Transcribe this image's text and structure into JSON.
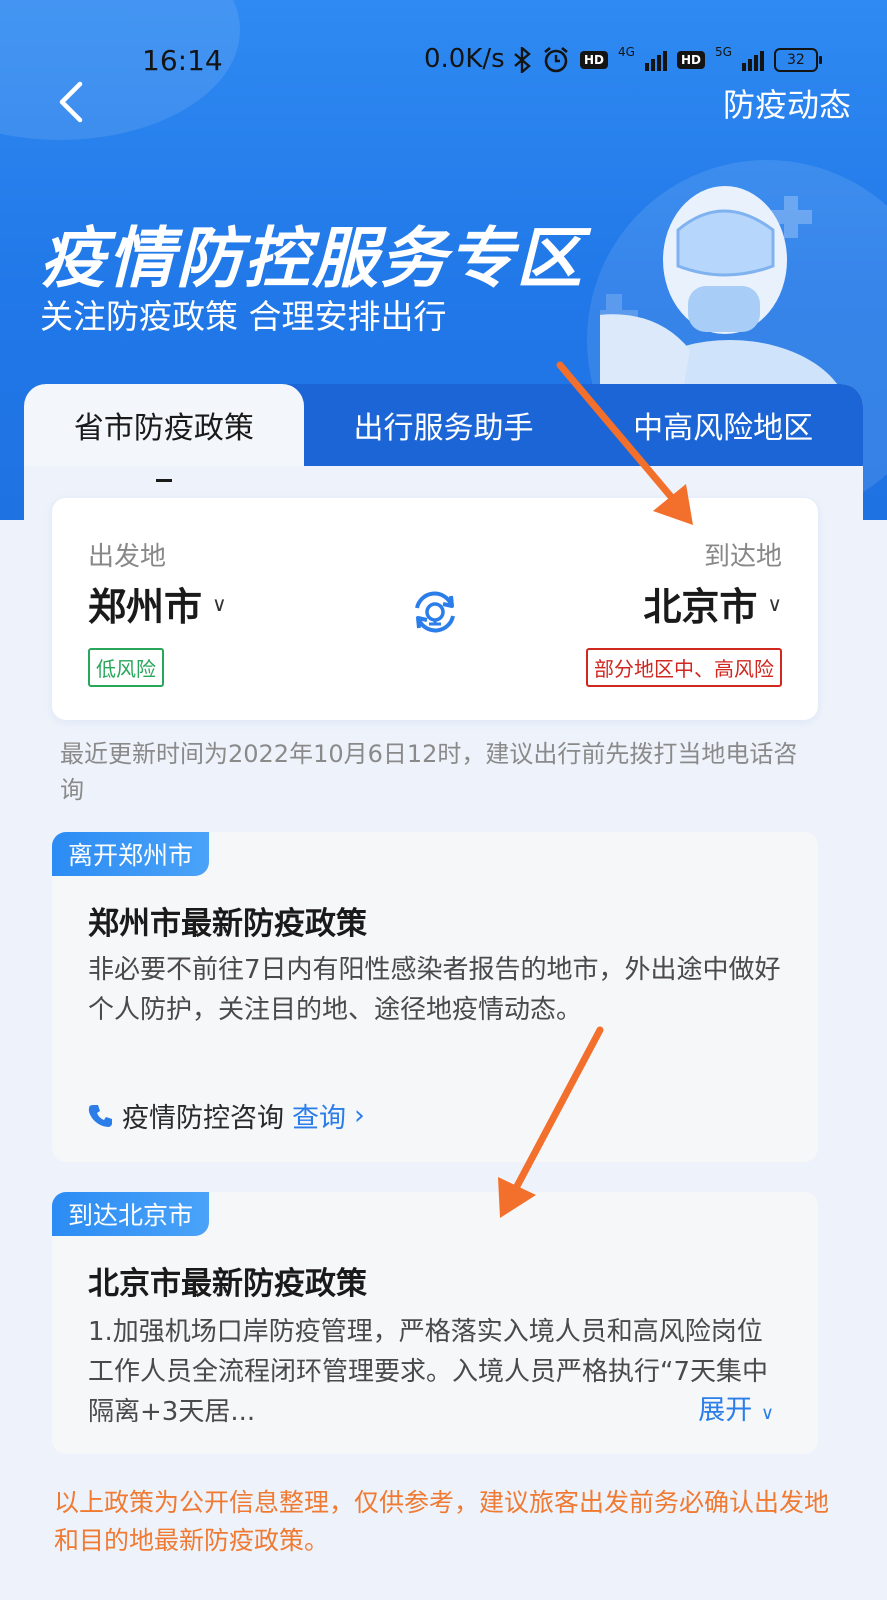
{
  "status_bar": {
    "time": "16:14",
    "net_speed": "0.0K/s",
    "net1": "4G",
    "net2": "5G",
    "hd_label": "HD",
    "battery": "32"
  },
  "header": {
    "back_icon": "back-chevron-icon",
    "link_label": "防疫动态"
  },
  "hero": {
    "title": "疫情防控服务专区",
    "subtitle": "关注防疫政策 合理安排出行"
  },
  "tabs": [
    {
      "label": "省市防疫政策",
      "active": true
    },
    {
      "label": "出行服务助手",
      "active": false
    },
    {
      "label": "中高风险地区",
      "active": false
    }
  ],
  "route": {
    "from_label": "出发地",
    "from_city": "郑州市",
    "from_risk": "低风险",
    "to_label": "到达地",
    "to_city": "北京市",
    "to_risk": "部分地区中、高风险"
  },
  "update_note": "最近更新时间为2022年10月6日12时，建议出行前先拨打当地电话咨询",
  "leave_card": {
    "tag": "离开郑州市",
    "title": "郑州市最新防疫政策",
    "body": "非必要不前往7日内有阳性感染者报告的地市，外出途中做好个人防护，关注目的地、途径地疫情动态。",
    "consult_label": "疫情防控咨询",
    "consult_link": "查询"
  },
  "arrive_card": {
    "tag": "到达北京市",
    "title": "北京市最新防疫政策",
    "body": "1.加强机场口岸防疫管理，严格落实入境人员和高风险岗位工作人员全流程闭环管理要求。入境人员严格执行“7天集中隔离+3天居...",
    "expand": "展开"
  },
  "disclaimer": "以上政策为公开信息整理，仅供参考，建议旅客出发前务必确认出发地和目的地最新防疫政策。",
  "colors": {
    "primary": "#2178e8",
    "tab_bar": "#1c65d6",
    "low_risk": "#28a65a",
    "high_risk": "#d0271f",
    "notice": "#f07a32",
    "arrow": "#f36f2c"
  }
}
